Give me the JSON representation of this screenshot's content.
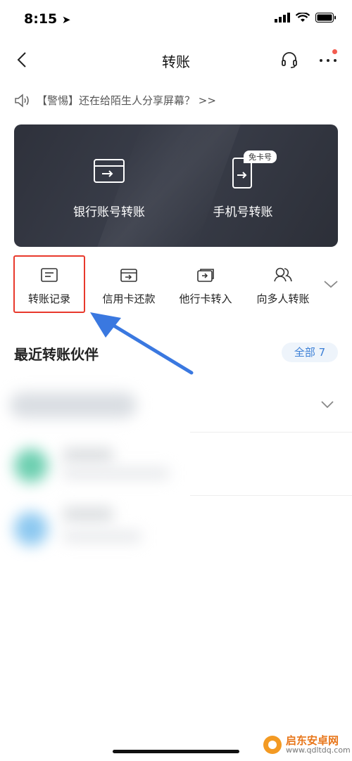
{
  "status": {
    "time": "8:15"
  },
  "nav": {
    "title": "转账"
  },
  "notice": {
    "text": "【警惕】还在给陌生人分享屏幕？ >>"
  },
  "card": {
    "items": [
      {
        "label": "银行账号转账",
        "icon": "bank-card-transfer-icon"
      },
      {
        "label": "手机号转账",
        "icon": "phone-transfer-icon"
      }
    ],
    "badge": "免卡号"
  },
  "quick_actions": [
    {
      "label": "转账记录",
      "icon": "record-icon"
    },
    {
      "label": "信用卡还款",
      "icon": "credit-card-icon"
    },
    {
      "label": "他行卡转入",
      "icon": "transfer-in-icon"
    },
    {
      "label": "向多人转账",
      "icon": "multi-people-icon"
    }
  ],
  "recent": {
    "title": "最近转账伙伴",
    "all_label": "全部 7"
  },
  "watermark": {
    "title": "启东安卓网",
    "url": "www.qdltdq.com"
  },
  "colors": {
    "highlight": "#e8392c",
    "arrow": "#3a78e0",
    "accent": "#3c7fd6",
    "card_bg": "#30333d"
  }
}
